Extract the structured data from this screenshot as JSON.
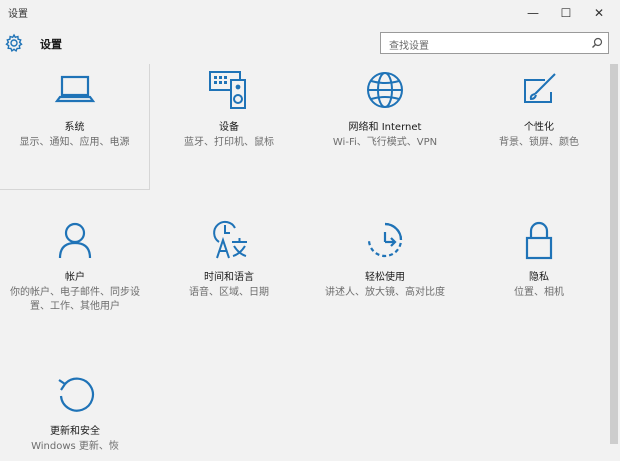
{
  "window": {
    "title": "设置",
    "minimize_glyph": "—",
    "maximize_glyph": "☐",
    "close_glyph": "✕"
  },
  "header": {
    "title": "设置",
    "search_placeholder": "查找设置"
  },
  "colors": {
    "accent": "#1f73b7",
    "background": "#f2f2f2"
  },
  "tiles": [
    {
      "icon": "laptop-icon",
      "title": "系统",
      "description": "显示、通知、应用、电源"
    },
    {
      "icon": "devices-icon",
      "title": "设备",
      "description": "蓝牙、打印机、鼠标"
    },
    {
      "icon": "globe-icon",
      "title": "网络和 Internet",
      "description": "Wi-Fi、飞行模式、VPN"
    },
    {
      "icon": "personalization-icon",
      "title": "个性化",
      "description": "背景、锁屏、颜色"
    },
    {
      "icon": "account-icon",
      "title": "帐户",
      "description": "你的帐户、电子邮件、同步设置、工作、其他用户"
    },
    {
      "icon": "time-language-icon",
      "title": "时间和语言",
      "description": "语音、区域、日期"
    },
    {
      "icon": "ease-of-access-icon",
      "title": "轻松使用",
      "description": "讲述人、放大镜、高对比度"
    },
    {
      "icon": "lock-icon",
      "title": "隐私",
      "description": "位置、相机"
    },
    {
      "icon": "update-icon",
      "title": "更新和安全",
      "description": "Windows 更新、恢"
    }
  ]
}
